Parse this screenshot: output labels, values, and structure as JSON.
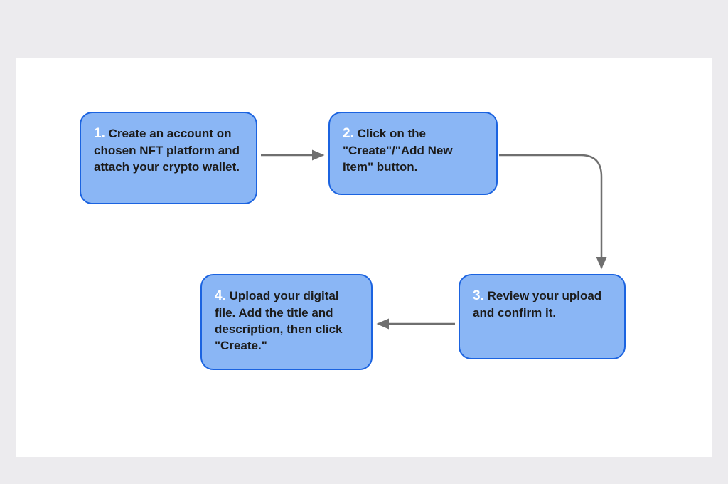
{
  "steps": [
    {
      "number": "1.",
      "text": "Create an account on chosen NFT platform and attach your crypto wallet."
    },
    {
      "number": "2.",
      "text": "Click on the \"Create\"/\"Add New Item\" button."
    },
    {
      "number": "3.",
      "text": "Review your upload and confirm it."
    },
    {
      "number": "4.",
      "text": "Upload your digital file. Add the title and description, then click \"Create.\""
    }
  ]
}
